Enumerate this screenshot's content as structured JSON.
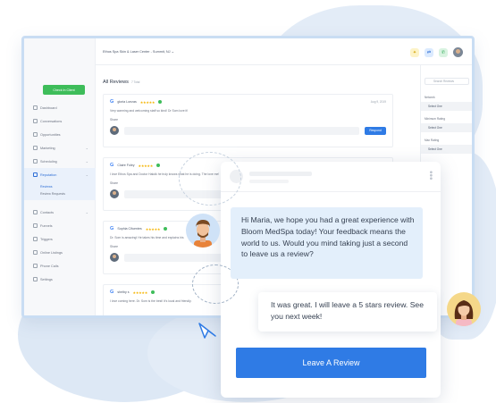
{
  "app": {
    "location": "Ethos Spa Skin & Laser Center - Summit, NJ",
    "check_in_label": "Check In Client",
    "nav": [
      {
        "label": "Dashboard",
        "icon": "dashboard-icon"
      },
      {
        "label": "Conversations",
        "icon": "chat-icon"
      },
      {
        "label": "Opportunities",
        "icon": "funnel-icon"
      },
      {
        "label": "Marketing",
        "icon": "megaphone-icon",
        "caret": true
      },
      {
        "label": "Scheduling",
        "icon": "calendar-icon",
        "caret": true
      },
      {
        "label": "Reputation",
        "icon": "star-icon",
        "caret": true,
        "active": true
      }
    ],
    "subnav": [
      "Reviews",
      "Review Requests"
    ],
    "nav2": [
      {
        "label": "Contacts",
        "icon": "contacts-icon",
        "caret": true
      },
      {
        "label": "Funnels",
        "icon": "funnels-icon"
      },
      {
        "label": "Triggers",
        "icon": "trigger-icon"
      },
      {
        "label": "Online Listings",
        "icon": "listings-icon"
      },
      {
        "label": "Phone Calls",
        "icon": "phone-icon"
      },
      {
        "label": "Settings",
        "icon": "settings-icon"
      }
    ],
    "topbar_icons": [
      "megaphone-icon",
      "sync-icon",
      "phone-icon"
    ],
    "all_reviews_title": "All Reviews",
    "all_reviews_count": "7 Total",
    "reviews": [
      {
        "name": "gloria Loezas",
        "stars": "★★★★★",
        "date": "Aug 9, 2019",
        "text": "Very warming and welcoming staff so kind! Dr Som love it!",
        "share": "Share",
        "respond": "Respond"
      },
      {
        "name": "Claire Foley",
        "stars": "★★★★★",
        "date": "",
        "text": "I love Ethos Spa and Doctor Hakdk he truly knows what he is doing. The love me!",
        "share": "Share",
        "respond": ""
      },
      {
        "name": "Sophia Cifuentes",
        "stars": "★★★★★",
        "date": "",
        "text": "Dr. Som is amazing! He takes his time and explains his",
        "share": "Share",
        "respond": ""
      },
      {
        "name": "shelby s",
        "stars": "★★★★★",
        "date": "",
        "text": "I love coming here. Dr. Som is the best! It's local and friendly.",
        "share": "",
        "respond": ""
      }
    ],
    "right_panel": {
      "search_placeholder": "Search Reviews",
      "network_label": "Network",
      "network_value": "Select One",
      "min_rating_label": "Minimum Rating",
      "min_rating_value": "Select One",
      "max_rating_label": "Max Rating",
      "max_rating_value": "Select One"
    }
  },
  "chat": {
    "incoming": "Hi Maria, we hope you had a great experience with Bloom MedSpa today! Your feedback means the world to us. Would you mind taking just a second to leave us a review?",
    "reply": "It was great. I will leave a 5 stars review. See you next week!",
    "cta": "Leave A Review"
  },
  "colors": {
    "accent": "#2f7be5",
    "success": "#3ebd5a",
    "star": "#f5b400",
    "frame": "#c9ddf3"
  }
}
